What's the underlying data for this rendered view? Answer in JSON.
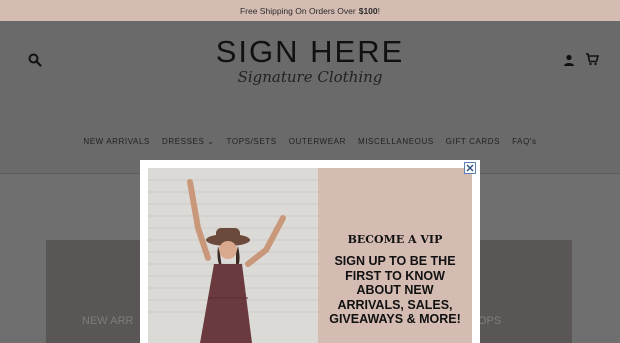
{
  "announcement": {
    "text": "Free Shipping On Orders Over",
    "amount": "$100",
    "bang": "!"
  },
  "header": {
    "logo_main": "SIGN HERE",
    "logo_script": "Signature Clothing",
    "icons": [
      "search-icon",
      "account-icon",
      "cart-icon"
    ]
  },
  "nav": {
    "items": [
      {
        "label": "NEW ARRIVALS"
      },
      {
        "label": "DRESSES ⌄"
      },
      {
        "label": "TOPS/SETS"
      },
      {
        "label": "OUTERWEAR"
      },
      {
        "label": "MISCELLANEOUS"
      },
      {
        "label": "GIFT CARDS"
      },
      {
        "label": "FAQ's"
      }
    ]
  },
  "background": {
    "left_label": "NEW ARR",
    "right_label": "OPS"
  },
  "modal": {
    "title": "BECOME A VIP",
    "body": "SIGN UP TO BE THE FIRST TO KNOW ABOUT NEW ARRIVALS, SALES, GIVEAWAYS & MORE!",
    "close_icon": "close-icon"
  },
  "colors": {
    "announcement_bg": "#d4bcb3",
    "modal_panel_bg": "#d4bcb3",
    "overlay": "#6a6a6a"
  }
}
